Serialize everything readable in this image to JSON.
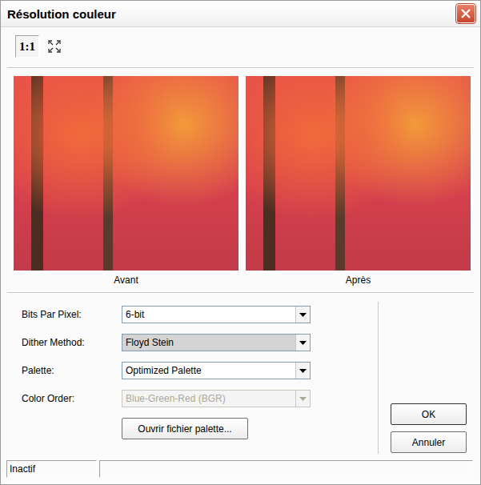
{
  "window": {
    "title": "Résolution couleur"
  },
  "zoom_buttons": [
    {
      "kind": "actual-size",
      "label": "1:1",
      "selected": true
    },
    {
      "kind": "fit",
      "selected": false
    }
  ],
  "previews": [
    {
      "caption": "Avant"
    },
    {
      "caption": "Après"
    }
  ],
  "fields": [
    {
      "label": "Bits Par Pixel:",
      "value": "6-bit",
      "disabled": false,
      "highlighted": false
    },
    {
      "label": "Dither Method:",
      "value": "Floyd Stein",
      "disabled": false,
      "highlighted": true
    },
    {
      "label": "Palette:",
      "value": "Optimized Palette",
      "disabled": false,
      "highlighted": false
    },
    {
      "label": "Color Order:",
      "value": "Blue-Green-Red (BGR)",
      "disabled": true,
      "highlighted": false
    }
  ],
  "palette_button": "Ouvrir fichier palette...",
  "buttons": [
    {
      "label": "OK",
      "default": true
    },
    {
      "label": "Annuler",
      "default": false
    }
  ],
  "status_bar": {
    "text": "Inactif"
  }
}
